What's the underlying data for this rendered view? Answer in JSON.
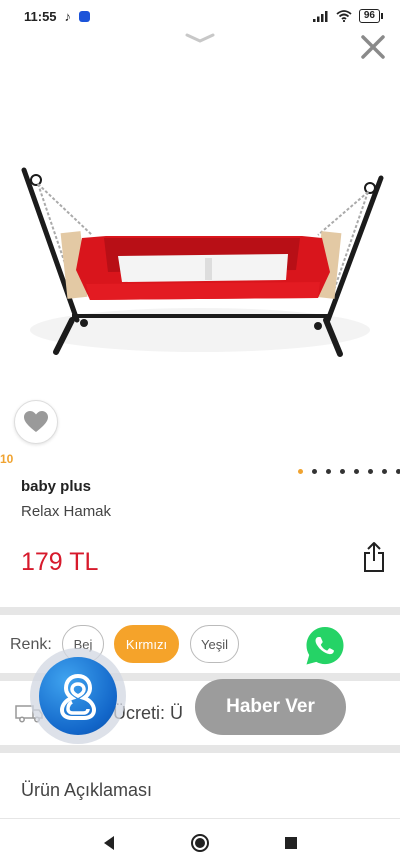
{
  "status_bar": {
    "time": "11:55",
    "battery": "96"
  },
  "product": {
    "image_counter": "10",
    "brand": "baby plus",
    "name": "Relax Hamak",
    "price": "179 TL",
    "pager": {
      "count": 8,
      "active_index": 0
    }
  },
  "color_selector": {
    "label": "Renk:",
    "options": [
      {
        "label": "Bej",
        "selected": false
      },
      {
        "label": "Kırmızı",
        "selected": true
      },
      {
        "label": "Yeşil",
        "selected": false
      }
    ]
  },
  "shipping": {
    "label": "Ücreti: Ü"
  },
  "notify_button": {
    "label": "Haber Ver"
  },
  "description": {
    "title": "Ürün Açıklaması"
  },
  "colors": {
    "accent": "#f5a32a",
    "price": "#d71a2c",
    "whatsapp": "#25d366",
    "notify": "#9c9c9c"
  }
}
